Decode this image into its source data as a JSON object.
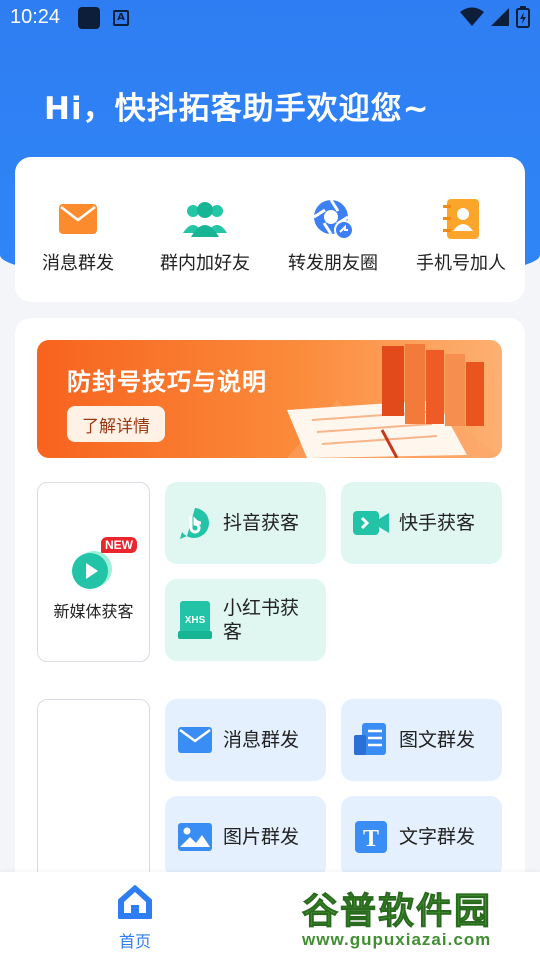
{
  "status_bar": {
    "time": "10:24",
    "input_icon_letter": "A"
  },
  "header": {
    "greeting": "Hi，快抖拓客助手欢迎您~"
  },
  "quick_actions": [
    {
      "label": "消息群发",
      "icon": "envelope-icon"
    },
    {
      "label": "群内加好友",
      "icon": "group-icon"
    },
    {
      "label": "转发朋友圈",
      "icon": "moments-icon"
    },
    {
      "label": "手机号加人",
      "icon": "contacts-icon"
    }
  ],
  "banner": {
    "title": "防封号技巧与说明",
    "button_label": "了解详情"
  },
  "media_section": {
    "card_label": "新媒体获客",
    "badge": "NEW",
    "tiles": [
      {
        "label": "抖音获客",
        "icon": "douyin-icon"
      },
      {
        "label": "快手获客",
        "icon": "kuaishou-icon"
      },
      {
        "label": "小红书获客",
        "icon": "xiaohongshu-icon",
        "icon_text": "XHS"
      }
    ]
  },
  "message_section": {
    "tiles": [
      {
        "label": "消息群发",
        "icon": "envelope-icon"
      },
      {
        "label": "图文群发",
        "icon": "article-icon"
      },
      {
        "label": "图片群发",
        "icon": "image-icon"
      },
      {
        "label": "文字群发",
        "icon": "text-icon",
        "icon_text": "T"
      }
    ]
  },
  "bottom_nav": {
    "home_label": "首页"
  },
  "watermark": {
    "title": "谷普软件园",
    "url": "www.gupuxiazai.com"
  },
  "colors": {
    "primary": "#2f7df2",
    "teal": "#22c3a6",
    "orange": "#f7631f",
    "tile_green": "#e0f7f1",
    "tile_blue": "#e4f0fd"
  }
}
